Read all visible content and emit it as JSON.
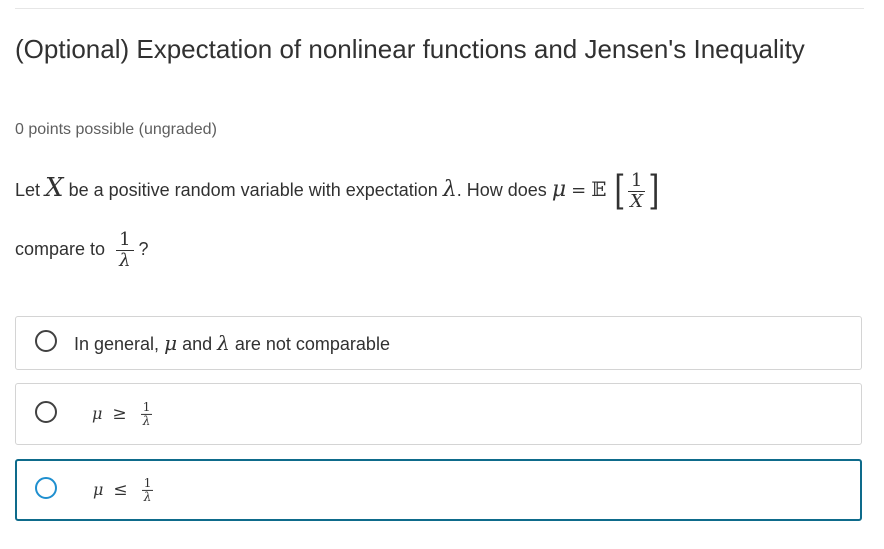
{
  "problem": {
    "title": "(Optional) Expectation of nonlinear functions and Jensen's Inequality",
    "points": "0 points possible (ungraded)"
  },
  "question": {
    "part1": "Let",
    "var_x": "X",
    "part2": "be a positive random variable with expectation",
    "var_lambda": "λ",
    "part3": ". How does",
    "var_mu": "μ",
    "equals": "=",
    "expect_op": "𝔼",
    "frac_num": "1",
    "frac_den": "X",
    "part4": "compare to",
    "cmp_num": "1",
    "cmp_den": "λ",
    "part5": "?"
  },
  "choices": [
    {
      "text_before": "In general,",
      "mu": "μ",
      "text_and": "and",
      "lambda": "λ",
      "text_after": "are not comparable"
    },
    {
      "mu": "μ",
      "relation": "≥",
      "num": "1",
      "den": "λ"
    },
    {
      "mu": "μ",
      "relation": "≤",
      "num": "1",
      "den": "λ"
    }
  ],
  "colors": {
    "focus_border": "#0e6b8b",
    "focus_radio": "#1f8fcf",
    "text": "#313131",
    "muted": "#5e5e5e"
  }
}
